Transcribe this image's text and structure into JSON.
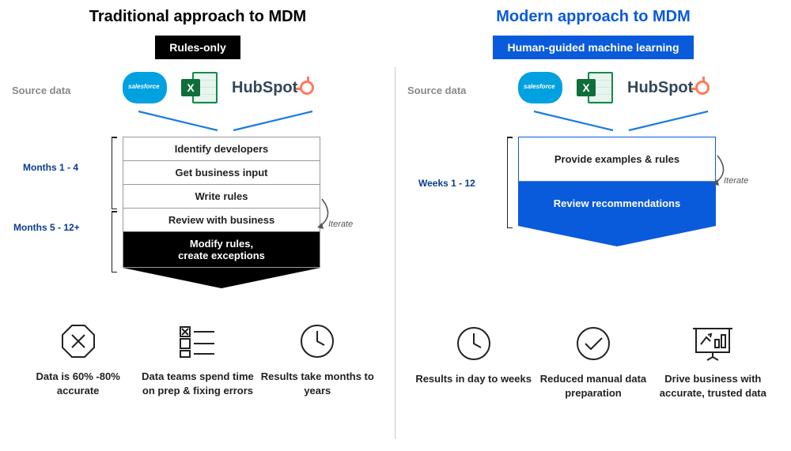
{
  "traditional": {
    "title": "Traditional approach to MDM",
    "badge": "Rules-only",
    "source_label": "Source data",
    "logos": {
      "salesforce": "salesforce",
      "excel": "X",
      "hubspot": "HubSpot"
    },
    "timeline1": "Months 1 - 4",
    "timeline2": "Months 5 - 12+",
    "iterate": "Iterate",
    "steps": [
      "Identify developers",
      "Get business input",
      "Write rules",
      "Review with business",
      "Modify rules,\ncreate exceptions"
    ],
    "outcomes": [
      {
        "icon": "octagon-x",
        "text": "Data is 60% -80% accurate"
      },
      {
        "icon": "checklist",
        "text": "Data teams spend time on prep & fixing errors"
      },
      {
        "icon": "clock",
        "text": "Results take months to years"
      }
    ]
  },
  "modern": {
    "title": "Modern approach to MDM",
    "badge": "Human-guided machine learning",
    "source_label": "Source data",
    "logos": {
      "salesforce": "salesforce",
      "excel": "X",
      "hubspot": "HubSpot"
    },
    "timeline1": "Weeks 1 - 12",
    "iterate": "Iterate",
    "steps": [
      "Provide examples & rules",
      "Review recommendations"
    ],
    "outcomes": [
      {
        "icon": "clock",
        "text": "Results in day to weeks"
      },
      {
        "icon": "circle-check",
        "text": "Reduced manual data preparation"
      },
      {
        "icon": "presentation",
        "text": "Drive business with accurate, trusted data"
      }
    ]
  }
}
